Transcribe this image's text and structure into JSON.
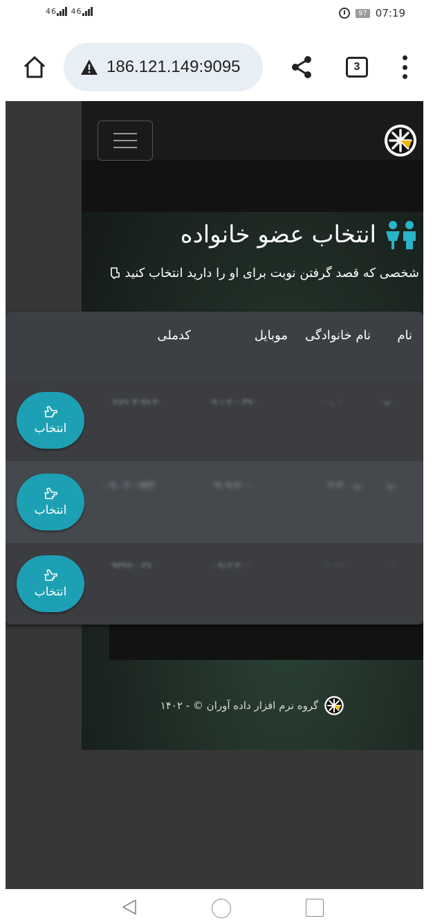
{
  "status_bar": {
    "signal_left": "46",
    "signal_right": "46",
    "battery": "97",
    "time": "07:19"
  },
  "browser": {
    "url": "186.121.149:9095",
    "tab_count": "3"
  },
  "page": {
    "title": "انتخاب عضو خانواده",
    "subtitle": "شخصی که قصد گرفتن نوبت برای او را دارید انتخاب کنید",
    "table": {
      "headers": [
        "نام",
        "نام خانوادگی",
        "موبایل",
        "کدملی"
      ],
      "rows": [
        {
          "first_name": "·‌·ه·",
          "last_name": "· ·, ·",
          "mobile": "·۹·۱·۲·۰·۳۹·",
          "national_id": "·۲۸۹۰۴·۹۹·۴·"
        },
        {
          "first_name": "·ه·",
          "last_name": "·۲·ه·۰ ۳·",
          "mobile": "·۹۰۹·۲·۰·",
          "national_id": "·۰۹۰·۲·۰۹۴۲"
        },
        {
          "first_name": "· ·",
          "last_name": "·· ·۰·",
          "mobile": "·۰۹۱۲·۲·۰·",
          "national_id": "·۹۳۹۹·۰·۲۷"
        }
      ],
      "select_label": "انتخاب"
    },
    "footer": "گروه نرم افزار داده آوران © - ۱۴۰۲"
  }
}
